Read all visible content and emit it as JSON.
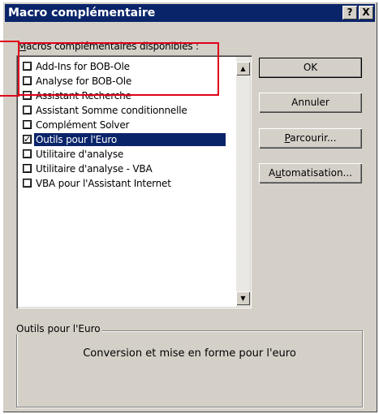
{
  "window": {
    "title": "Macro complémentaire",
    "help_label": "?",
    "close_label": "X"
  },
  "list": {
    "label_prefix": "M",
    "label_rest": "acros complémentaires disponibles :",
    "items": [
      {
        "label": "Add-Ins for BOB-Ole",
        "checked": false
      },
      {
        "label": "Analyse for BOB-Ole",
        "checked": false
      },
      {
        "label": "Assistant Recherche",
        "checked": false
      },
      {
        "label": "Assistant Somme conditionnelle",
        "checked": false
      },
      {
        "label": "Complément Solver",
        "checked": false
      },
      {
        "label": "Outils pour l'Euro",
        "checked": true,
        "selected": true
      },
      {
        "label": "Utilitaire d'analyse",
        "checked": false
      },
      {
        "label": "Utilitaire d'analyse - VBA",
        "checked": false
      },
      {
        "label": "VBA pour l'Assistant Internet",
        "checked": false
      }
    ],
    "check_mark": "✓",
    "scroll_up": "▲",
    "scroll_down": "▼"
  },
  "buttons": {
    "ok": "OK",
    "cancel": "Annuler",
    "browse_pre": "",
    "browse_key": "P",
    "browse_rest": "arcourir...",
    "auto_pre": "A",
    "auto_key": "u",
    "auto_rest": "tomatisation..."
  },
  "description": {
    "group_title": "Outils pour l'Euro",
    "text": "Conversion et mise en forme pour l'euro"
  },
  "colors": {
    "title_bar": "#0a246a",
    "dialog_bg": "#d4d0c8",
    "highlight": "#e0001a"
  }
}
